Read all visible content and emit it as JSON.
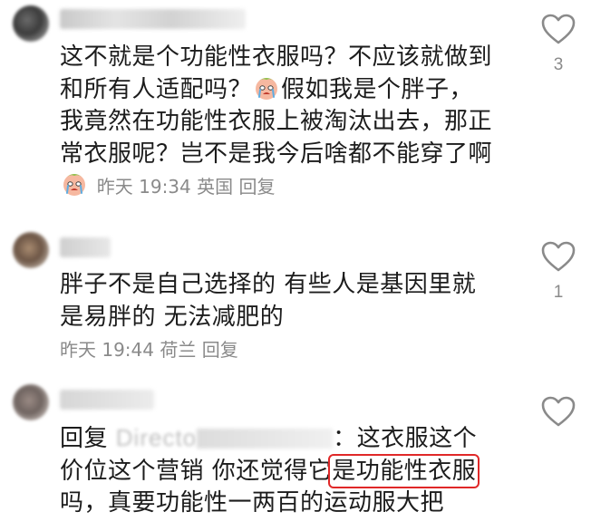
{
  "comments": [
    {
      "text_parts": [
        "这不就是个功能性衣服吗？不应该就做到和所有人适配吗？",
        "假如我是个胖子，我竟然在功能性衣服上被淘汰出去，那正常衣服呢？岂不是我今后啥都不能穿了啊"
      ],
      "emoji": "crying-face",
      "meta": "昨天 19:34 英国",
      "reply": "回复",
      "likes": "3"
    },
    {
      "text": "胖子不是自己选择的 有些人是基因里就是易胖的 无法减肥的",
      "meta": "昨天 19:44 荷兰",
      "reply": "回复",
      "likes": "1"
    },
    {
      "reply_prefix": "回复",
      "reply_to": "Directo",
      "text_before": "：这衣服这个价位这个营销 你还觉得它",
      "highlighted": "是功能性衣服",
      "text_after": "吗，真要功能性一两百的运动服大把",
      "likes": ""
    }
  ],
  "colors": {
    "text": "#1c1c1c",
    "meta": "#8a8a8a",
    "highlight_border": "#e02828",
    "heart": "#8a8a8a"
  },
  "icons": {
    "like": "heart-outline-icon",
    "emoji": "crying-face-emoji"
  }
}
